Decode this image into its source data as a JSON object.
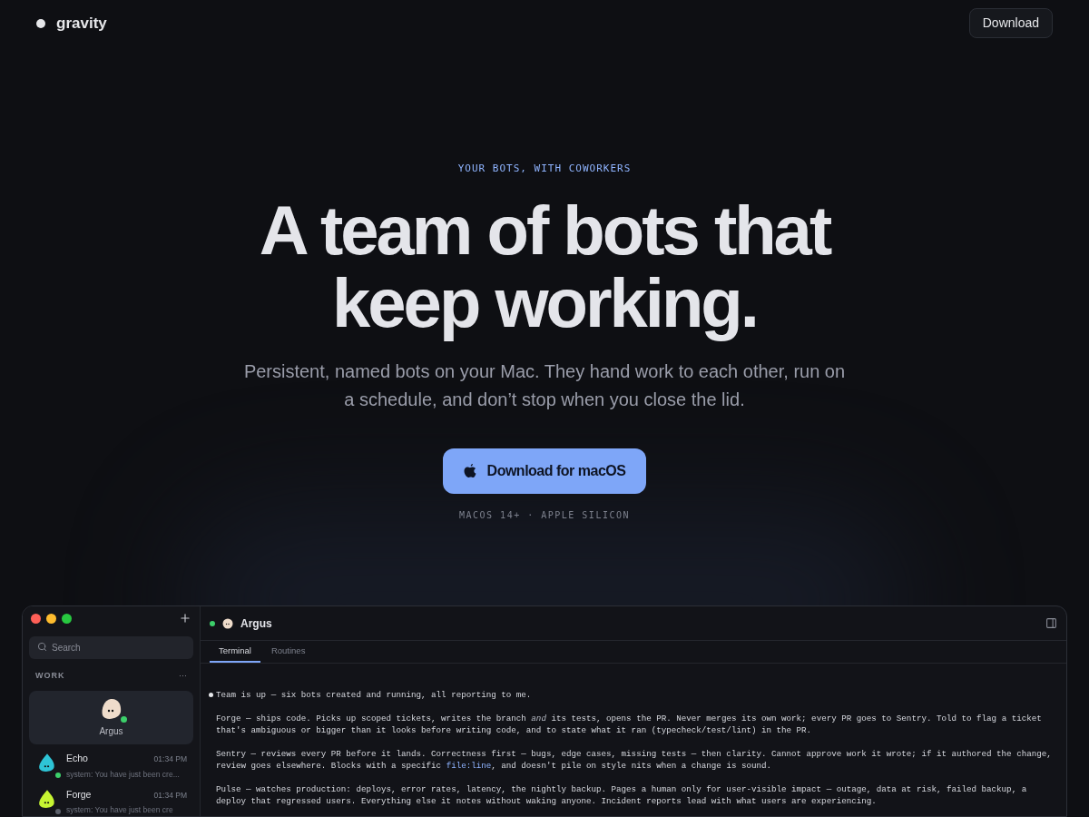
{
  "nav": {
    "brand": "gravity",
    "download": "Download"
  },
  "hero": {
    "eyebrow": "YOUR BOTS, WITH COWORKERS",
    "title_lines": [
      "A team of bots that",
      "keep working."
    ],
    "subtitle_lines": [
      "Persistent, named bots on your Mac. They hand work to each other, run on",
      "a schedule, and don’t stop when you close the lid."
    ],
    "cta": "Download for macOS",
    "note": "MACOS 14+ · APPLE SILICON"
  },
  "app": {
    "search": {
      "placeholder": "Search"
    },
    "section": "WORK",
    "more": "···",
    "selected_bot": {
      "name": "Argus",
      "online": true
    },
    "bots": [
      {
        "name": "Echo",
        "time": "01:34 PM",
        "preview": "system: You have just been cre...",
        "color": "#2ec4d6",
        "online": true
      },
      {
        "name": "Forge",
        "time": "01:34 PM",
        "preview": "system: You have just been cre",
        "color": "#c6f432",
        "online": false
      }
    ],
    "header": {
      "name": "Argus",
      "online": true
    },
    "tabs": [
      {
        "label": "Terminal",
        "selected": true
      },
      {
        "label": "Routines",
        "selected": false
      }
    ],
    "terminal": [
      {
        "bullet": true,
        "lines": [
          [
            {
              "text": "Team is up — six bots created and running, all reporting to me.",
              "kind": "plain"
            }
          ]
        ]
      },
      {
        "bullet": false,
        "lines": [
          [
            {
              "text": "Forge — ships code. Picks up scoped tickets, writes the branch ",
              "kind": "plain"
            },
            {
              "text": "and",
              "kind": "italic"
            },
            {
              "text": " its tests, opens the PR. Never merges its own work; every PR goes to Sentry. Told to flag a ticket",
              "kind": "plain"
            }
          ],
          [
            {
              "text": "that's ambiguous or bigger than it looks before writing code, and to state what it ran (typecheck/test/lint) in the PR.",
              "kind": "plain"
            }
          ]
        ]
      },
      {
        "bullet": false,
        "lines": [
          [
            {
              "text": "Sentry — reviews every PR before it lands. Correctness first — bugs, edge cases, missing tests — then clarity. Cannot approve work it wrote; if it authored the change,",
              "kind": "plain"
            }
          ],
          [
            {
              "text": "review goes elsewhere. Blocks with a specific ",
              "kind": "plain"
            },
            {
              "text": "file:line",
              "kind": "path"
            },
            {
              "text": ", and doesn't pile on style nits when a change is sound.",
              "kind": "plain"
            }
          ]
        ]
      },
      {
        "bullet": false,
        "lines": [
          [
            {
              "text": "Pulse — watches production: deploys, error rates, latency, the nightly backup. Pages a human only for user-visible impact — outage, data at risk, failed backup, a",
              "kind": "plain"
            }
          ],
          [
            {
              "text": "deploy that regressed users. Everything else it notes without waking anyone. Incident reports lead with what users are experiencing.",
              "kind": "plain"
            }
          ]
        ]
      }
    ]
  }
}
